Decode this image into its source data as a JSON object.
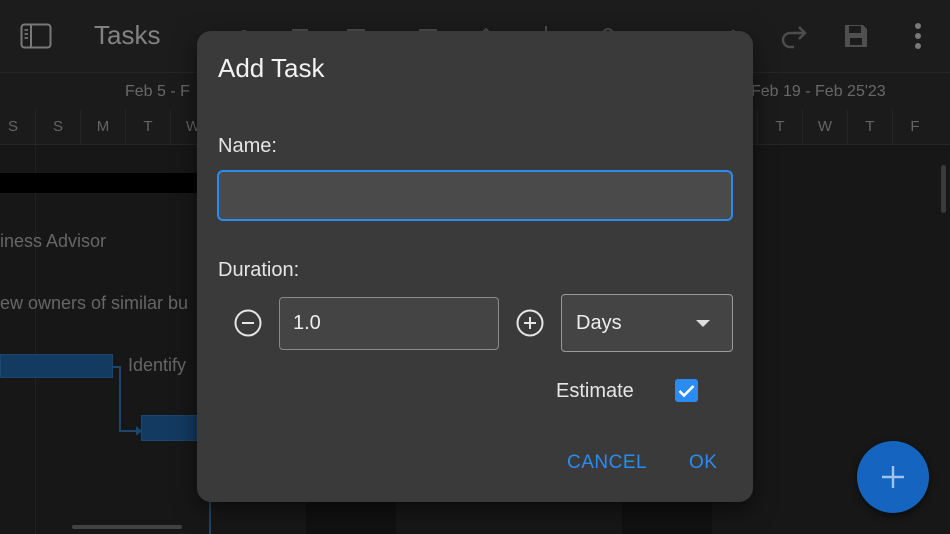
{
  "toolbar": {
    "title": "Tasks",
    "icons": [
      "sidebar-toggle-icon",
      "link-icon",
      "trash-icon",
      "outdent-icon",
      "indent-icon",
      "move-up-icon",
      "move-down-icon",
      "people-icon",
      "undo-arrow-icon",
      "check-icon",
      "redo-icon",
      "save-icon",
      "more-vertical-icon"
    ]
  },
  "timeline": {
    "week_left": "Feb 5 - F",
    "week_right": "Feb 19 - Feb 25'23",
    "days_left": [
      "S",
      "S",
      "M",
      "T",
      "W"
    ],
    "days_right": [
      "T",
      "W",
      "T",
      "F"
    ]
  },
  "gantt": {
    "row1": "iness Advisor",
    "row2": "ew owners of similar bu",
    "row3": "Identify"
  },
  "dialog": {
    "title": "Add Task",
    "name_label": "Name:",
    "name_value": "",
    "duration_label": "Duration:",
    "duration_value": "1.0",
    "unit_value": "Days",
    "estimate_label": "Estimate",
    "estimate_checked": true,
    "cancel_label": "CANCEL",
    "ok_label": "OK"
  },
  "colors": {
    "accent": "#2a8cf0",
    "fab": "#1565c0",
    "bar": "#1e5a96"
  }
}
